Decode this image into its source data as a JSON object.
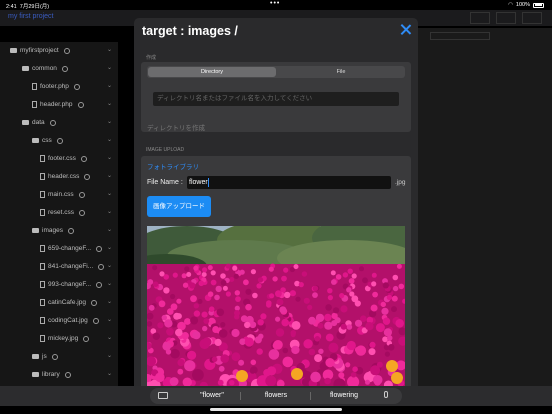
{
  "status": {
    "time": "2:41",
    "date": "7月29日(月)",
    "battery": "100%"
  },
  "app": {
    "project_title": "my first project",
    "toolbar": [
      "CHECK",
      "CONVERT",
      "SAVE"
    ]
  },
  "tree": [
    {
      "label": "myfirstproject",
      "type": "folder",
      "depth": 0
    },
    {
      "label": "common",
      "type": "folder",
      "depth": 1
    },
    {
      "label": "footer.php",
      "type": "file",
      "depth": 2
    },
    {
      "label": "header.php",
      "type": "file",
      "depth": 2
    },
    {
      "label": "data",
      "type": "folder",
      "depth": 1
    },
    {
      "label": "css",
      "type": "folder",
      "depth": 2
    },
    {
      "label": "footer.css",
      "type": "file",
      "depth": 3
    },
    {
      "label": "header.css",
      "type": "file",
      "depth": 3
    },
    {
      "label": "main.css",
      "type": "file",
      "depth": 3
    },
    {
      "label": "reset.css",
      "type": "file",
      "depth": 3
    },
    {
      "label": "images",
      "type": "folder",
      "depth": 2
    },
    {
      "label": "659-changeF...",
      "type": "file",
      "depth": 3
    },
    {
      "label": "841-changeFi...",
      "type": "file",
      "depth": 3
    },
    {
      "label": "993-changeF...",
      "type": "file",
      "depth": 3
    },
    {
      "label": "catinCafe.jpg",
      "type": "file",
      "depth": 3
    },
    {
      "label": "codingCat.jpg",
      "type": "file",
      "depth": 3
    },
    {
      "label": "mickey.jpg",
      "type": "file",
      "depth": 3
    },
    {
      "label": "js",
      "type": "folder",
      "depth": 2
    },
    {
      "label": "library",
      "type": "folder",
      "depth": 2
    }
  ],
  "modal": {
    "title": "target : images /",
    "create_section": "作成",
    "seg_directory": "Directory",
    "seg_file": "File",
    "dir_placeholder": "ディレクトリ名またはファイル名を入力してください",
    "create_dir_label": "ディレクトリを作成",
    "upload_section": "IMAGE UPLOAD",
    "photo_library": "フォトライブラリ",
    "filename_label": "File Name :",
    "filename_value": "flower",
    "extension": ".jpg",
    "upload_button": "画像アップロード"
  },
  "keyboard": {
    "suggestions": [
      "\"flower\"",
      "flowers",
      "flowering"
    ]
  },
  "colors": {
    "accent": "#2f8cf7",
    "flowers": "#d2127c"
  }
}
